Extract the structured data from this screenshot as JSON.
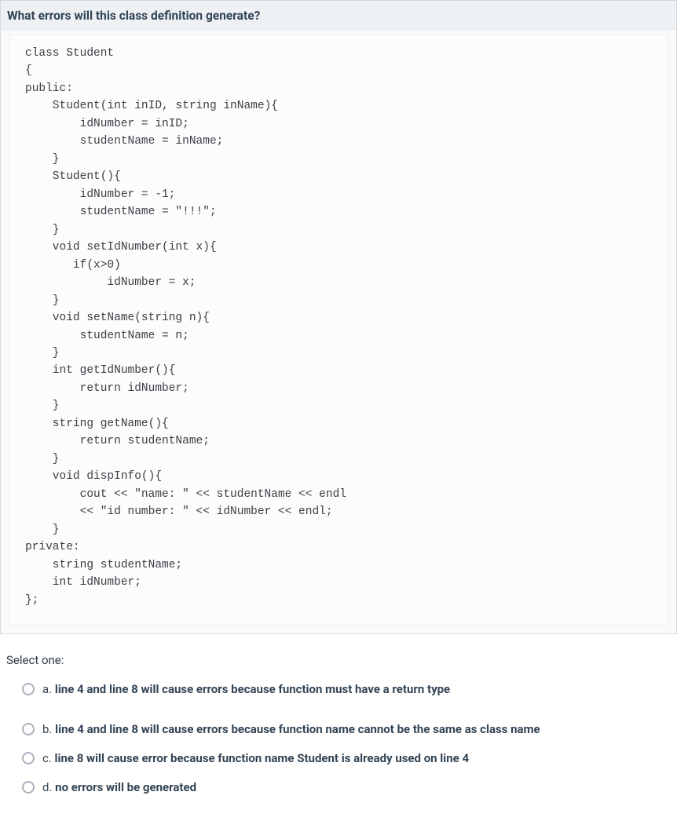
{
  "question": {
    "title": "What errors will this class definition generate?",
    "code": "class Student\n{\npublic:\n    Student(int inID, string inName){\n        idNumber = inID;\n        studentName = inName;\n    }\n    Student(){\n        idNumber = -1;\n        studentName = \"!!!\";\n    }\n    void setIdNumber(int x){\n       if(x>0)\n            idNumber = x;\n    }\n    void setName(string n){\n        studentName = n;\n    }\n    int getIdNumber(){\n        return idNumber;\n    }\n    string getName(){\n        return studentName;\n    }\n    void dispInfo(){\n        cout << \"name: \" << studentName << endl\n        << \"id number: \" << idNumber << endl;\n    }\nprivate:\n    string studentName;\n    int idNumber;\n};"
  },
  "answer": {
    "prompt": "Select one:",
    "options": [
      {
        "letter": "a.",
        "text": "line 4 and line 8 will cause errors because function must have a return type"
      },
      {
        "letter": "b.",
        "text": "line 4 and line 8 will cause errors because function name cannot be the same as class name"
      },
      {
        "letter": "c.",
        "text": "line 8 will cause error because function name Student is already used on line 4"
      },
      {
        "letter": "d.",
        "text": "no errors will be generated"
      }
    ]
  }
}
